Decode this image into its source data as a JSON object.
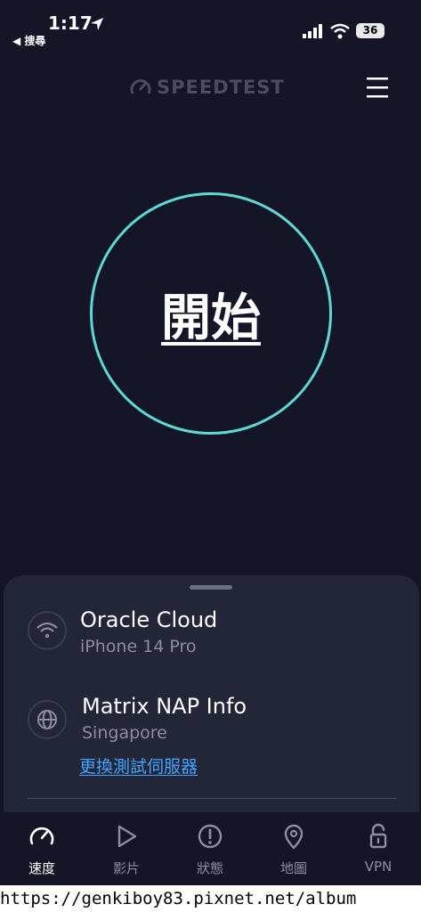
{
  "status_bar": {
    "time": "1:17",
    "back_label": "◀ 搜尋",
    "battery": "36"
  },
  "header": {
    "logo_text": "SPEEDTEST",
    "menu_icon": "hamburger-icon"
  },
  "start_button": {
    "label": "開始",
    "ring_color": "#5bd9d5"
  },
  "connection": {
    "provider": "Oracle Cloud",
    "device": "iPhone 14 Pro",
    "icon": "wifi-icon"
  },
  "server": {
    "name": "Matrix NAP Info",
    "location": "Singapore",
    "change_label": "更換測試伺服器",
    "icon": "globe-icon",
    "link_color": "#41a6ff"
  },
  "tabs": [
    {
      "label": "速度",
      "icon": "speedometer-icon",
      "active": true
    },
    {
      "label": "影片",
      "icon": "play-icon",
      "active": false
    },
    {
      "label": "狀態",
      "icon": "alert-icon",
      "active": false
    },
    {
      "label": "地圖",
      "icon": "map-pin-icon",
      "active": false
    },
    {
      "label": "VPN",
      "icon": "lock-icon",
      "active": false
    }
  ],
  "watermark": "https://genkiboy83.pixnet.net/album"
}
